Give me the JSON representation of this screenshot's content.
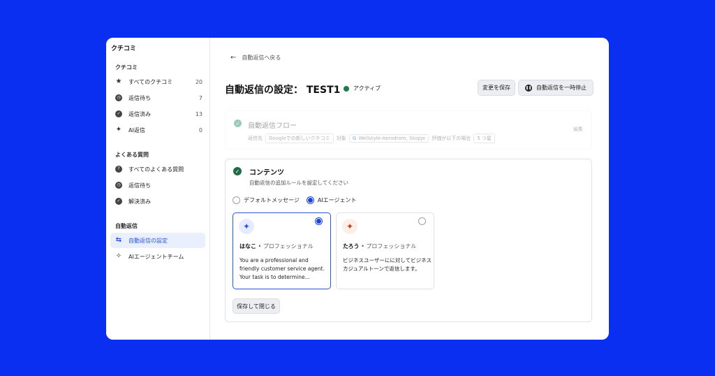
{
  "app": {
    "brand": "クチコミ"
  },
  "sidebar": {
    "sections": [
      {
        "title": "クチコミ",
        "items": [
          {
            "label": "すべてのクチコミ",
            "count": "20",
            "icon": "star-icon"
          },
          {
            "label": "返信待ち",
            "count": "7",
            "icon": "clock-icon"
          },
          {
            "label": "返信済み",
            "count": "13",
            "icon": "check-circle-icon"
          },
          {
            "label": "AI返信",
            "count": "0",
            "icon": "sparkle-icon"
          }
        ]
      },
      {
        "title": "よくある質問",
        "items": [
          {
            "label": "すべてのよくある質問",
            "icon": "question-circle-icon"
          },
          {
            "label": "返信待ち",
            "icon": "clock-icon"
          },
          {
            "label": "解決済み",
            "icon": "check-circle-icon"
          }
        ]
      },
      {
        "title": "自動返信",
        "items": [
          {
            "label": "自動返信の設定",
            "icon": "auto-reply-icon",
            "active": true
          },
          {
            "label": "AIエージェントチーム",
            "icon": "sparkles-icon"
          }
        ]
      }
    ]
  },
  "main": {
    "back_label": "自動返信へ戻る",
    "title": "自動返信の設定： TEST1",
    "status": "アクティブ",
    "save_changes": "変更を保存",
    "pause_button": "自動返信を一時停止",
    "flow": {
      "title": "自動返信フロー",
      "prefix": "返信先",
      "source": "Googleでの新しいクチコミ",
      "target_label": "対象",
      "location": "Wellstyle-Aerodrom, Skopje",
      "condition": "評価が以下の場合",
      "stars": "5 つ星",
      "edit": "編集"
    },
    "content": {
      "title": "コンテンツ",
      "subtitle": "自動返信の追加ルールを設定してください",
      "option_default": "デフォルトメッセージ",
      "option_ai": "AIエージェント",
      "agents": [
        {
          "name": "はなこ",
          "separator": "•",
          "role": "プロフェッショナル",
          "description": "You are a professional and friendly customer service agent. Your task is to determine...",
          "selected": true
        },
        {
          "name": "たろう",
          "separator": "•",
          "role": "プロフェッショナル",
          "description": "ビジネスユーザーにに対してビジネスカジュアルトーンで返信します。",
          "selected": false
        }
      ],
      "save_close": "保存して閉じる"
    }
  },
  "colors": {
    "background": "#0a2ff0",
    "accent": "#1b45d8",
    "active_status": "#1f7a4d"
  }
}
